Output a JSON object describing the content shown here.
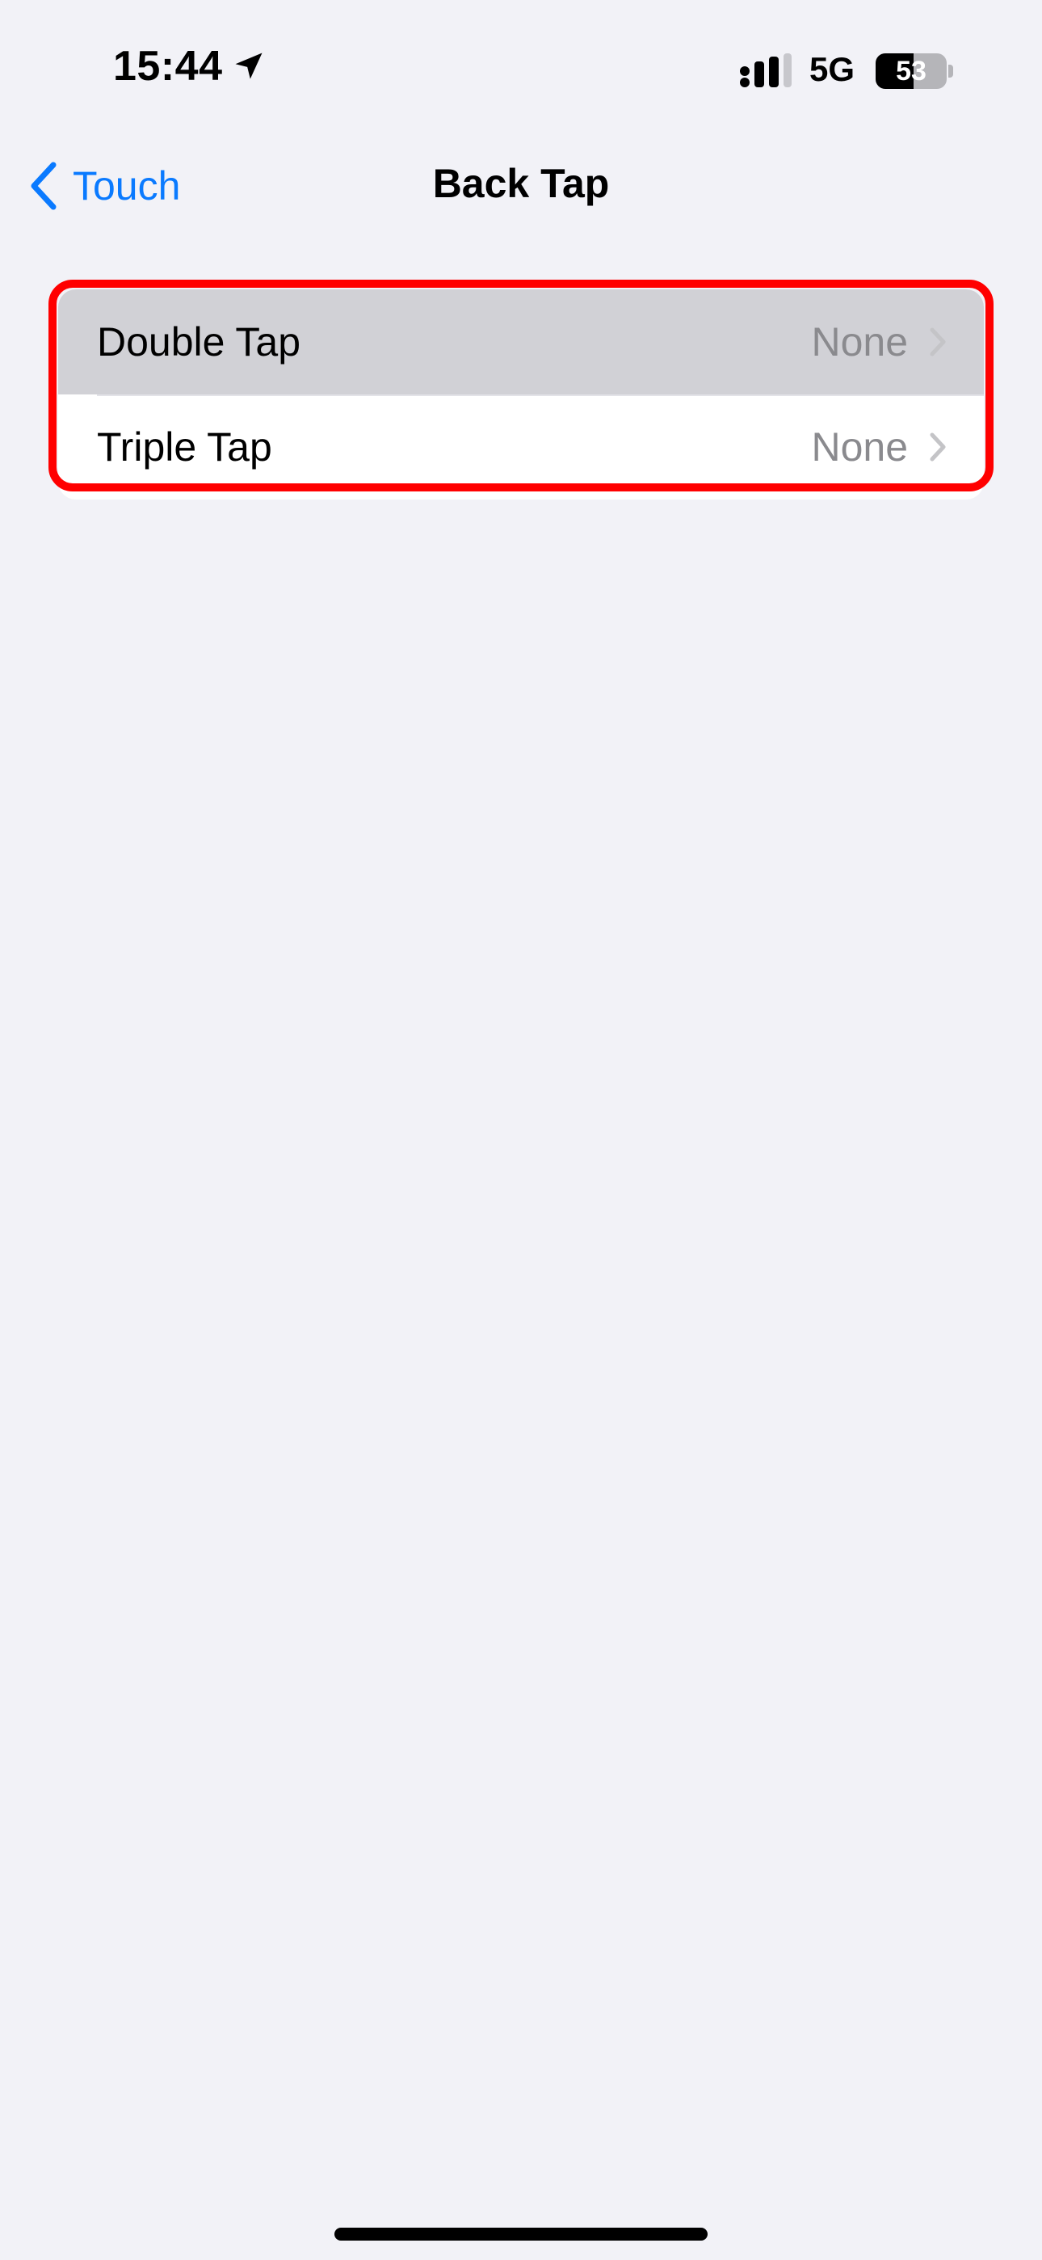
{
  "status_bar": {
    "time": "15:44",
    "network": "5G",
    "battery": "53",
    "battery_level": 0.53
  },
  "nav": {
    "back_label": "Touch",
    "title": "Back Tap"
  },
  "rows": [
    {
      "label": "Double Tap",
      "value": "None",
      "highlighted": true
    },
    {
      "label": "Triple Tap",
      "value": "None",
      "highlighted": false
    }
  ],
  "colors": {
    "accent": "#0a7aff",
    "background": "#f2f2f7",
    "annotation": "#ff0000"
  },
  "icons": {
    "location": "location-arrow-icon",
    "signal": "cellular-signal-icon",
    "back": "chevron-left-icon",
    "disclosure": "chevron-right-icon"
  }
}
